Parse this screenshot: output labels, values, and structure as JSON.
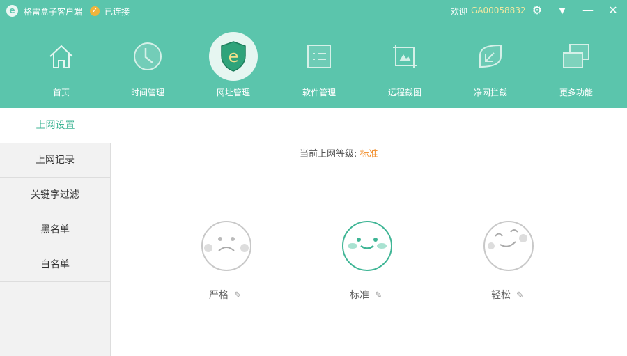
{
  "titlebar": {
    "app_name": "格雷盒子客户端",
    "status": "已连接",
    "welcome": "欢迎",
    "user_id": "GA00058832"
  },
  "nav": [
    {
      "label": "首页",
      "icon": "home-icon"
    },
    {
      "label": "时间管理",
      "icon": "clock-icon"
    },
    {
      "label": "网址管理",
      "icon": "shield-e-icon"
    },
    {
      "label": "软件管理",
      "icon": "list-icon"
    },
    {
      "label": "远程截图",
      "icon": "crop-image-icon"
    },
    {
      "label": "净网拦截",
      "icon": "leaf-icon"
    },
    {
      "label": "更多功能",
      "icon": "windows-icon"
    }
  ],
  "sidebar": [
    {
      "label": "上网设置"
    },
    {
      "label": "上网记录"
    },
    {
      "label": "关键字过滤"
    },
    {
      "label": "黑名单"
    },
    {
      "label": "白名单"
    }
  ],
  "main": {
    "level_label": "当前上网等级: ",
    "level_value": "标准",
    "levels": [
      {
        "label": "严格"
      },
      {
        "label": "标准"
      },
      {
        "label": "轻松"
      }
    ]
  },
  "colors": {
    "brand": "#5bc5ac",
    "accent": "#f08a24",
    "active": "#3fb595"
  }
}
